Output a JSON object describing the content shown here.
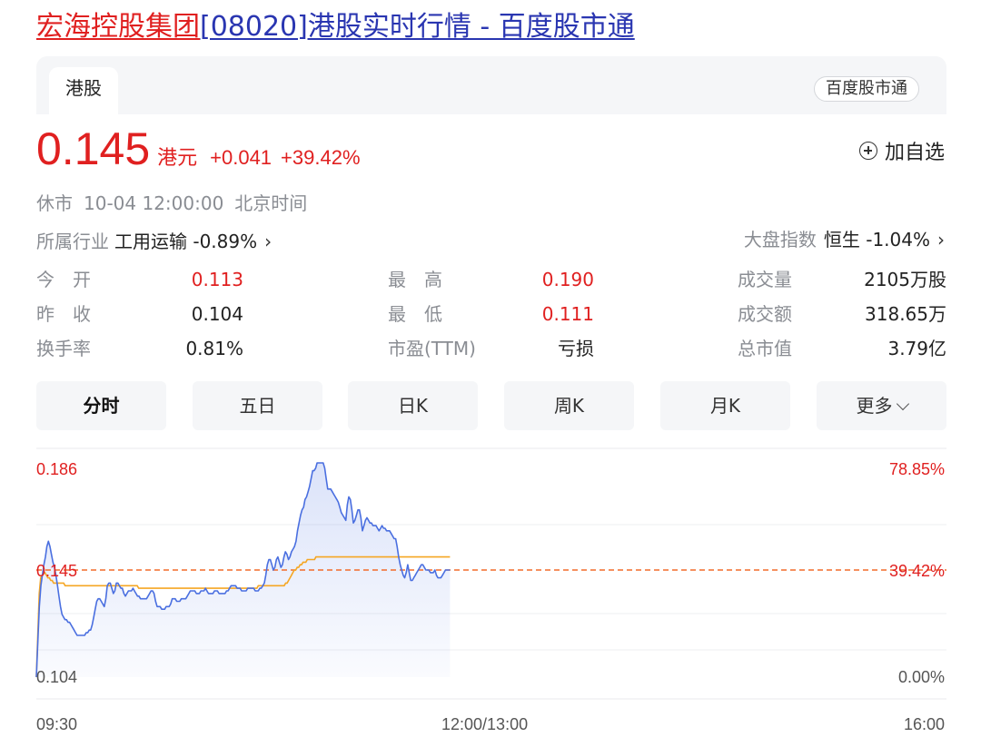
{
  "page_title": {
    "name": "宏海控股集团",
    "rest": "[08020]港股实时行情 - 百度股市通"
  },
  "tabs": {
    "active": "港股",
    "badge": "百度股市通"
  },
  "quote": {
    "price": "0.145",
    "currency": "港元",
    "change": "+0.041",
    "change_pct": "+39.42%",
    "watch_label": "加自选"
  },
  "status": {
    "state": "休市",
    "time": "10-04 12:00:00",
    "zone": "北京时间"
  },
  "industry": {
    "label": "所属行业",
    "name": "工用运输",
    "change": "-0.89%"
  },
  "market_index": {
    "label": "大盘指数",
    "name": "恒生",
    "change": "-1.04%"
  },
  "stats": [
    {
      "label": "今　开",
      "value": "0.113",
      "color": "red"
    },
    {
      "label": "最　高",
      "value": "0.190",
      "color": "red"
    },
    {
      "label": "成交量",
      "value": "2105万股",
      "color": "normal"
    },
    {
      "label": "昨　收",
      "value": "0.104",
      "color": "normal"
    },
    {
      "label": "最　低",
      "value": "0.111",
      "color": "red"
    },
    {
      "label": "成交额",
      "value": "318.65万",
      "color": "normal"
    },
    {
      "label": "换手率",
      "value": "0.81%",
      "color": "normal"
    },
    {
      "label": "市盈(TTM)",
      "value": "亏损",
      "color": "normal"
    },
    {
      "label": "总市值",
      "value": "3.79亿",
      "color": "normal"
    }
  ],
  "periods": [
    "分时",
    "五日",
    "日K",
    "周K",
    "月K",
    "更多"
  ],
  "active_period": "分时",
  "colors": {
    "up": "#e02020",
    "link": "#2a36b1",
    "price_line": "#4a6fe0",
    "avg_line": "#f5a623",
    "ref_line": "#f26b2a"
  },
  "chart_data": {
    "type": "line",
    "y_left_labels": [
      "0.186",
      "0.145",
      "0.104"
    ],
    "y_right_labels": [
      "78.85%",
      "39.42%",
      "0.00%"
    ],
    "x_labels": [
      "09:30",
      "12:00/13:00",
      "16:00"
    ],
    "ylim": [
      0.104,
      0.186
    ],
    "reference": 0.145,
    "session_fraction": 0.4545,
    "series": [
      {
        "values": [
          0.104,
          0.118,
          0.131,
          0.139,
          0.143,
          0.147,
          0.15,
          0.154,
          0.156,
          0.154,
          0.151,
          0.148,
          0.146,
          0.143,
          0.139,
          0.135,
          0.131,
          0.128,
          0.127,
          0.126,
          0.126,
          0.125,
          0.125,
          0.124,
          0.123,
          0.122,
          0.121,
          0.12,
          0.12,
          0.12,
          0.12,
          0.12,
          0.12,
          0.121,
          0.121,
          0.122,
          0.122,
          0.124,
          0.127,
          0.13,
          0.133,
          0.134,
          0.134,
          0.133,
          0.132,
          0.131,
          0.134,
          0.139,
          0.14,
          0.14,
          0.138,
          0.136,
          0.137,
          0.14,
          0.14,
          0.139,
          0.138,
          0.138,
          0.136,
          0.135,
          0.136,
          0.137,
          0.137,
          0.137,
          0.138,
          0.137,
          0.136,
          0.135,
          0.135,
          0.134,
          0.134,
          0.134,
          0.134,
          0.134,
          0.135,
          0.136,
          0.137,
          0.137,
          0.136,
          0.133,
          0.131,
          0.131,
          0.131,
          0.13,
          0.13,
          0.13,
          0.131,
          0.131,
          0.131,
          0.132,
          0.134,
          0.134,
          0.134,
          0.133,
          0.133,
          0.133,
          0.134,
          0.134,
          0.134,
          0.134,
          0.135,
          0.136,
          0.137,
          0.137,
          0.137,
          0.137,
          0.136,
          0.136,
          0.136,
          0.137,
          0.137,
          0.137,
          0.138,
          0.137,
          0.136,
          0.136,
          0.136,
          0.136,
          0.137,
          0.137,
          0.137,
          0.136,
          0.136,
          0.136,
          0.136,
          0.136,
          0.137,
          0.137,
          0.138,
          0.139,
          0.139,
          0.139,
          0.139,
          0.138,
          0.138,
          0.138,
          0.137,
          0.137,
          0.137,
          0.137,
          0.138,
          0.138,
          0.138,
          0.138,
          0.138,
          0.137,
          0.137,
          0.137,
          0.138,
          0.138,
          0.139,
          0.14,
          0.143,
          0.147,
          0.149,
          0.149,
          0.147,
          0.145,
          0.146,
          0.149,
          0.15,
          0.148,
          0.146,
          0.147,
          0.15,
          0.152,
          0.151,
          0.149,
          0.15,
          0.152,
          0.153,
          0.154,
          0.156,
          0.16,
          0.163,
          0.166,
          0.168,
          0.169,
          0.172,
          0.173,
          0.175,
          0.177,
          0.18,
          0.183,
          0.183,
          0.184,
          0.186,
          0.186,
          0.186,
          0.186,
          0.186,
          0.184,
          0.18,
          0.176,
          0.176,
          0.176,
          0.175,
          0.174,
          0.173,
          0.172,
          0.171,
          0.169,
          0.167,
          0.166,
          0.165,
          0.164,
          0.17,
          0.173,
          0.172,
          0.168,
          0.163,
          0.164,
          0.166,
          0.168,
          0.168,
          0.165,
          0.16,
          0.162,
          0.164,
          0.165,
          0.164,
          0.163,
          0.163,
          0.162,
          0.162,
          0.162,
          0.161,
          0.16,
          0.161,
          0.162,
          0.161,
          0.161,
          0.16,
          0.16,
          0.16,
          0.159,
          0.158,
          0.157,
          0.157,
          0.154,
          0.15,
          0.147,
          0.145,
          0.143,
          0.142,
          0.144,
          0.147,
          0.144,
          0.141,
          0.141,
          0.142,
          0.143,
          0.144,
          0.145,
          0.146,
          0.147,
          0.147,
          0.146,
          0.145,
          0.145,
          0.145,
          0.144,
          0.144,
          0.144,
          0.145,
          0.143,
          0.142,
          0.142,
          0.142,
          0.143,
          0.144,
          0.145,
          0.145,
          0.145,
          0.145
        ]
      },
      {
        "values": [
          0.104,
          0.12,
          0.136,
          0.142,
          0.143,
          0.144,
          0.144,
          0.143,
          0.142,
          0.142,
          0.141,
          0.141,
          0.14,
          0.14,
          0.14,
          0.14,
          0.14,
          0.14,
          0.14,
          0.14,
          0.139,
          0.139,
          0.139,
          0.139,
          0.139,
          0.139,
          0.139,
          0.139,
          0.139,
          0.139,
          0.139,
          0.139,
          0.139,
          0.139,
          0.139,
          0.139,
          0.139,
          0.139,
          0.139,
          0.139,
          0.139,
          0.139,
          0.139,
          0.139,
          0.139,
          0.139,
          0.139,
          0.139,
          0.139,
          0.139,
          0.139,
          0.139,
          0.139,
          0.139,
          0.139,
          0.139,
          0.139,
          0.139,
          0.139,
          0.139,
          0.139,
          0.139,
          0.139,
          0.139,
          0.139,
          0.139,
          0.139,
          0.139,
          0.139,
          0.139,
          0.139,
          0.138,
          0.138,
          0.138,
          0.138,
          0.138,
          0.138,
          0.138,
          0.138,
          0.138,
          0.138,
          0.138,
          0.138,
          0.138,
          0.138,
          0.138,
          0.138,
          0.138,
          0.138,
          0.138,
          0.138,
          0.138,
          0.138,
          0.138,
          0.138,
          0.138,
          0.138,
          0.138,
          0.138,
          0.138,
          0.138,
          0.138,
          0.138,
          0.138,
          0.138,
          0.138,
          0.138,
          0.138,
          0.138,
          0.138,
          0.138,
          0.138,
          0.138,
          0.138,
          0.138,
          0.138,
          0.138,
          0.138,
          0.138,
          0.138,
          0.138,
          0.138,
          0.138,
          0.138,
          0.138,
          0.138,
          0.138,
          0.138,
          0.138,
          0.138,
          0.138,
          0.138,
          0.138,
          0.138,
          0.138,
          0.138,
          0.138,
          0.138,
          0.138,
          0.138,
          0.138,
          0.138,
          0.138,
          0.138,
          0.138,
          0.138,
          0.138,
          0.138,
          0.138,
          0.138,
          0.138,
          0.138,
          0.138,
          0.138,
          0.139,
          0.139,
          0.139,
          0.139,
          0.139,
          0.139,
          0.139,
          0.139,
          0.139,
          0.139,
          0.139,
          0.139,
          0.139,
          0.139,
          0.139,
          0.139,
          0.139,
          0.139,
          0.139,
          0.14,
          0.14,
          0.141,
          0.142,
          0.143,
          0.144,
          0.145,
          0.145,
          0.146,
          0.146,
          0.147,
          0.147,
          0.148,
          0.148,
          0.148,
          0.149,
          0.149,
          0.149,
          0.149,
          0.149,
          0.149,
          0.15,
          0.15,
          0.15,
          0.15,
          0.15,
          0.15,
          0.15,
          0.15,
          0.15,
          0.15,
          0.15,
          0.15,
          0.15,
          0.15,
          0.15,
          0.15,
          0.15,
          0.15,
          0.15,
          0.15,
          0.15,
          0.15,
          0.15,
          0.15,
          0.15,
          0.15,
          0.15,
          0.15,
          0.15,
          0.15,
          0.15,
          0.15,
          0.15,
          0.15,
          0.15,
          0.15,
          0.15,
          0.15,
          0.15,
          0.15,
          0.15,
          0.15,
          0.15,
          0.15,
          0.15,
          0.15,
          0.15,
          0.15,
          0.15,
          0.15,
          0.15,
          0.15,
          0.15,
          0.15,
          0.15,
          0.15,
          0.15,
          0.15,
          0.15,
          0.15,
          0.15,
          0.15,
          0.15,
          0.15,
          0.15,
          0.15,
          0.15,
          0.15,
          0.15,
          0.15,
          0.15,
          0.15,
          0.15,
          0.15,
          0.15,
          0.15,
          0.15,
          0.15,
          0.15,
          0.15,
          0.15,
          0.15,
          0.15,
          0.15,
          0.15,
          0.15,
          0.15,
          0.15,
          0.15,
          0.15,
          0.15,
          0.15,
          0.15,
          0.15
        ]
      }
    ]
  }
}
